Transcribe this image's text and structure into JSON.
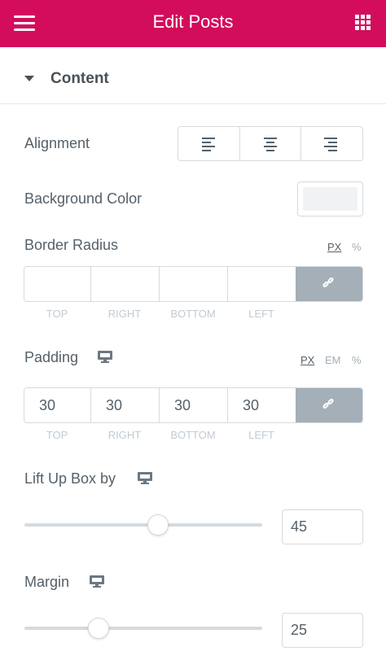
{
  "header": {
    "title": "Edit Posts",
    "background_color": "#d30c5c",
    "menu_icon": "hamburger-icon",
    "apps_icon": "grid-icon"
  },
  "section": {
    "label": "Content",
    "icon": "caret-down-icon"
  },
  "alignment": {
    "label": "Alignment",
    "options": [
      "align-left-icon",
      "align-center-icon",
      "align-right-icon"
    ]
  },
  "background_color": {
    "label": "Background Color",
    "swatch_color": "#f1f2f3"
  },
  "border_radius": {
    "label": "Border Radius",
    "units": [
      "PX",
      "%"
    ],
    "active_unit": "PX",
    "values": [
      "",
      "",
      "",
      ""
    ],
    "sides": [
      "TOP",
      "RIGHT",
      "BOTTOM",
      "LEFT"
    ],
    "link_icon": "link-icon"
  },
  "padding": {
    "label": "Padding",
    "responsive_icon": "desktop-icon",
    "units": [
      "PX",
      "EM",
      "%"
    ],
    "active_unit": "PX",
    "values": [
      "30",
      "30",
      "30",
      "30"
    ],
    "sides": [
      "TOP",
      "RIGHT",
      "BOTTOM",
      "LEFT"
    ],
    "link_icon": "link-icon"
  },
  "lift_up": {
    "label": "Lift Up Box by",
    "responsive_icon": "desktop-icon",
    "value": "45",
    "slider_fraction": 0.56
  },
  "margin": {
    "label": "Margin",
    "responsive_icon": "desktop-icon",
    "value": "25",
    "slider_fraction": 0.31
  }
}
